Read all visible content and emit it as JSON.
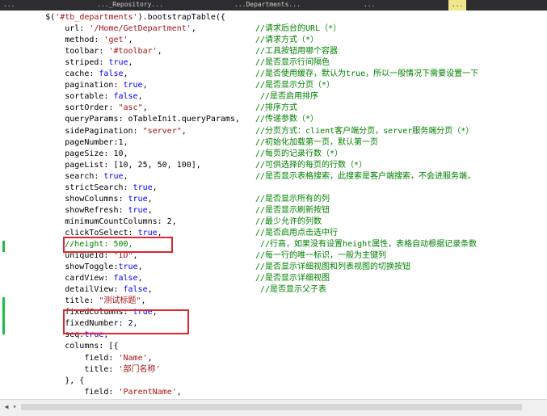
{
  "tabs": [
    "...",
    "..._Repository...",
    "...Departments...",
    "...",
    "..."
  ],
  "active_tab": "...",
  "lines": [
    {
      "code": "        $('#tb_departments').bootstrapTable({",
      "comment": ""
    },
    {
      "code": "            url: '/Home/GetDepartment',",
      "comment": "//请求后台的URL（*）"
    },
    {
      "code": "            method: 'get',",
      "comment": "//请求方式（*）"
    },
    {
      "code": "            toolbar: '#toolbar',",
      "comment": "//工具按钮用哪个容器"
    },
    {
      "code": "            striped: true,",
      "comment": "//是否显示行间隔色"
    },
    {
      "code": "            cache: false,",
      "comment": "//是否使用缓存，默认为true，所以一般情况下需要设置一下"
    },
    {
      "code": "            pagination: true,",
      "comment": "//是否显示分页（*）"
    },
    {
      "code": "            sortable: false,",
      "comment": " //是否启用排序"
    },
    {
      "code": "            sortOrder: \"asc\",",
      "comment": "//排序方式"
    },
    {
      "code": "            queryParams: oTableInit.queryParams,",
      "comment": "//传递参数（*）"
    },
    {
      "code": "            sidePagination: \"server\",",
      "comment": "//分页方式：client客户端分页，server服务端分页（*）"
    },
    {
      "code": "            pageNumber:1,",
      "comment": "//初始化加载第一页，默认第一页"
    },
    {
      "code": "            pageSize: 10,",
      "comment": "//每页的记录行数（*）"
    },
    {
      "code": "            pageList: [10, 25, 50, 100],",
      "comment": "//可供选择的每页的行数（*）"
    },
    {
      "code": "            search: true,",
      "comment": "//是否显示表格搜索，此搜索是客户端搜索，不会进服务端，"
    },
    {
      "code": "            strictSearch: true,",
      "comment": ""
    },
    {
      "code": "            showColumns: true,",
      "comment": "//是否显示所有的列"
    },
    {
      "code": "            showRefresh: true,",
      "comment": "//是否显示刷新按钮"
    },
    {
      "code": "            minimumCountColumns: 2,",
      "comment": "//最少允许的列数"
    },
    {
      "code": "            clickToSelect: true,",
      "comment": "//是否启用点击选中行"
    },
    {
      "code": "            //height: 500,",
      "comment": " //行高，如果没有设置height属性，表格自动根据记录条数"
    },
    {
      "code": "            uniqueId: \"ID\",",
      "comment": "//每一行的唯一标识，一般为主键列"
    },
    {
      "code": "            showToggle:true,",
      "comment": "//是否显示详细视图和列表视图的切换按钮"
    },
    {
      "code": "            cardView: false,",
      "comment": "//是否显示详细视图"
    },
    {
      "code": "            detailView: false,",
      "comment": " //是否显示父子表"
    },
    {
      "code": "            title: \"测试标题\",",
      "comment": ""
    },
    {
      "code": "            fixedColumns: true,",
      "comment": ""
    },
    {
      "code": "            fixedNumber: 2,",
      "comment": ""
    },
    {
      "code": "            seq:true,",
      "comment": ""
    },
    {
      "code": "            columns: [{",
      "comment": ""
    },
    {
      "code": "                field: 'Name',",
      "comment": ""
    },
    {
      "code": "                title: '部门名称'",
      "comment": ""
    },
    {
      "code": "            }, {",
      "comment": ""
    },
    {
      "code": "                field: 'ParentName',",
      "comment": ""
    }
  ],
  "colors": {
    "keyword": "#0000ff",
    "string": "#a31515",
    "comment": "#008000",
    "highlight_box": "#e0262e",
    "change_marker": "#1fb84a"
  }
}
